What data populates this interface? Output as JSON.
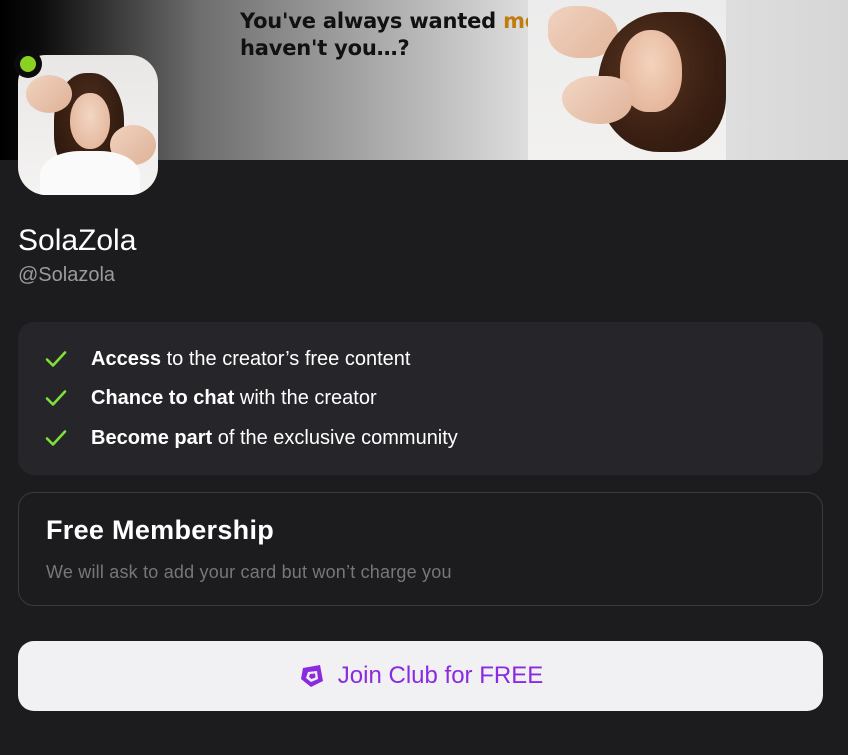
{
  "banner": {
    "headline_part1": "You've always wanted ",
    "headline_accent": "more",
    "headline_part2": ",",
    "headline_line2": "haven't you…?",
    "accent_color": "#c07c0e"
  },
  "profile": {
    "name": "SolaZola",
    "handle": "@Solazola",
    "status": "online",
    "status_color": "#8ad121"
  },
  "benefits": [
    {
      "bold": "Access",
      "rest": " to the creator’s free content",
      "icon": "check-icon"
    },
    {
      "bold": "Chance to chat",
      "rest": " with the creator",
      "icon": "check-icon"
    },
    {
      "bold": "Become part",
      "rest": " of the exclusive community",
      "icon": "check-icon"
    }
  ],
  "membership": {
    "title": "Free Membership",
    "subtitle": "We will ask to add your card but won’t charge you"
  },
  "join_button": {
    "label": "Join Club for FREE",
    "icon": "club-logo-icon",
    "color": "#8a2be2"
  },
  "colors": {
    "background": "#1c1c1f",
    "card": "#26262a",
    "check": "#7ee03a"
  }
}
